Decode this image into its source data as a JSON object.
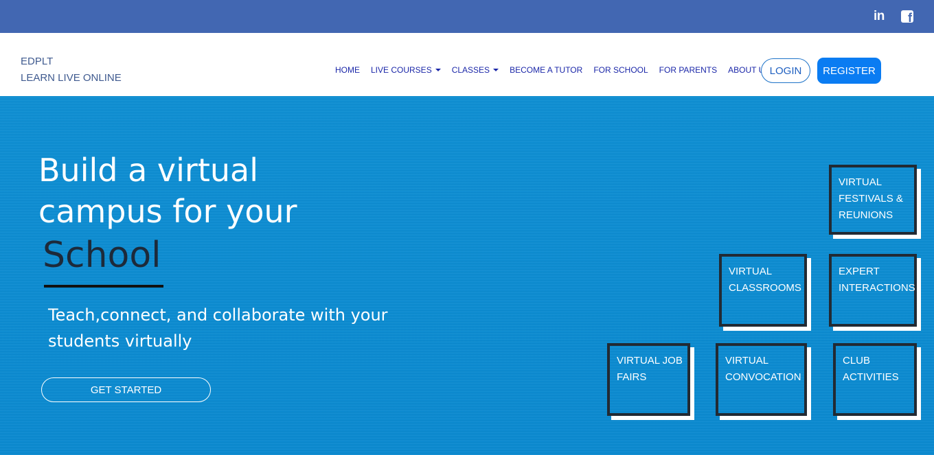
{
  "topbar": {
    "linkedin_icon": "linkedin-icon",
    "facebook_icon": "facebook-icon",
    "linkedin_glyph": "in",
    "facebook_glyph": "f"
  },
  "brand": {
    "line1": "EDPLT",
    "line2": "LEARN LIVE ONLINE"
  },
  "nav": {
    "items": [
      {
        "label": "HOME"
      },
      {
        "label": "LIVE COURSES"
      },
      {
        "label": "CLASSES"
      },
      {
        "label": "BECOME A TUTOR"
      },
      {
        "label": "FOR SCHOOL"
      },
      {
        "label": "FOR PARENTS"
      },
      {
        "label": "ABOUT US"
      }
    ],
    "login": "LOGIN",
    "register": "REGISTER"
  },
  "hero": {
    "headline_line1": "Build a virtual",
    "headline_line2": "campus for your",
    "headline_word": "School",
    "subheadline": "Teach,connect, and collaborate with your students virtually",
    "cta": "GET STARTED"
  },
  "tiles": [
    {
      "label": "VIRTUAL FESTIVALS & REUNIONS"
    },
    {
      "label": "VIRTUAL CLASSROOMS"
    },
    {
      "label": "EXPERT INTERACTIONS"
    },
    {
      "label": "VIRTUAL JOB FAIRS"
    },
    {
      "label": "VIRTUAL CONVOCATION"
    },
    {
      "label": "CLUB ACTIVITIES"
    }
  ],
  "colors": {
    "topbar": "#4267b2",
    "hero": "#0b8ad0",
    "register_button": "#0a7cf2",
    "tile_border": "#222a33"
  }
}
